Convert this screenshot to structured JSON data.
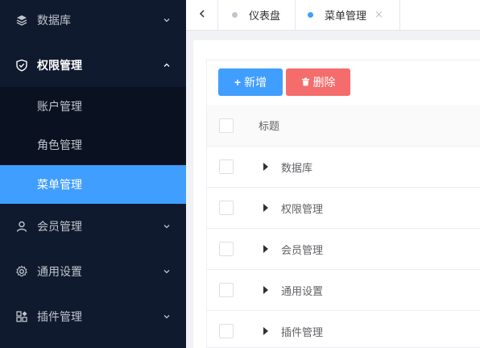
{
  "sidebar": {
    "items": [
      {
        "label": "数据库",
        "icon": "database-icon"
      },
      {
        "label": "权限管理",
        "icon": "shield-icon",
        "expanded": true,
        "children": [
          {
            "label": "账户管理"
          },
          {
            "label": "角色管理"
          },
          {
            "label": "菜单管理",
            "selected": true
          }
        ]
      },
      {
        "label": "会员管理",
        "icon": "user-icon"
      },
      {
        "label": "通用设置",
        "icon": "gear-icon"
      },
      {
        "label": "插件管理",
        "icon": "plugin-grid-icon"
      }
    ]
  },
  "tabs": [
    {
      "label": "仪表盘",
      "active": false
    },
    {
      "label": "菜单管理",
      "active": true,
      "close": "×"
    }
  ],
  "toolbar": {
    "add_label": "新增",
    "add_icon": "+",
    "delete_label": "删除"
  },
  "table": {
    "header": "标题",
    "rows": [
      "数据库",
      "权限管理",
      "会员管理",
      "通用设置",
      "插件管理"
    ]
  },
  "colors": {
    "sidebar_bg": "#0f1a2e",
    "accent": "#409eff",
    "danger": "#f56c6c"
  }
}
